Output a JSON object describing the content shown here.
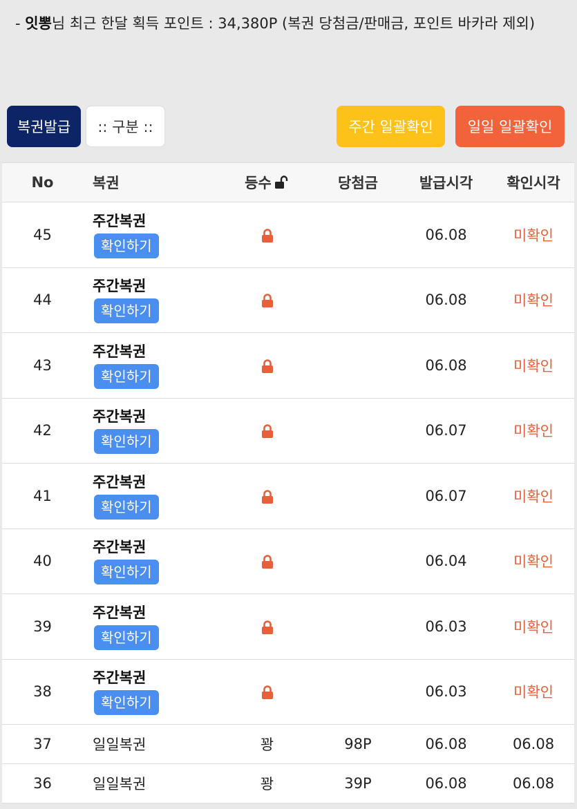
{
  "summary": {
    "prefix": "- ",
    "user": "잇뽕",
    "text": "님 최근 한달 획득 포인트 : 34,380P (복권 당첨금/판매금, 포인트 바카라 제외)"
  },
  "buttons": {
    "issue": "복권발급",
    "filter": ":: 구분 ::",
    "weekly_confirm": "주간 일괄확인",
    "daily_confirm": "일일 일괄확인"
  },
  "table": {
    "headers": {
      "no": "No",
      "lottery": "복권",
      "rank": "등수",
      "prize": "당첨금",
      "issued": "발급시각",
      "checked": "확인시각"
    },
    "rows": [
      {
        "no": "45",
        "name": "주간복권",
        "action": "확인하기",
        "issued": "06.08",
        "checked": "미확인"
      },
      {
        "no": "44",
        "name": "주간복권",
        "action": "확인하기",
        "issued": "06.08",
        "checked": "미확인"
      },
      {
        "no": "43",
        "name": "주간복권",
        "action": "확인하기",
        "issued": "06.08",
        "checked": "미확인"
      },
      {
        "no": "42",
        "name": "주간복권",
        "action": "확인하기",
        "issued": "06.07",
        "checked": "미확인"
      },
      {
        "no": "41",
        "name": "주간복권",
        "action": "확인하기",
        "issued": "06.07",
        "checked": "미확인"
      },
      {
        "no": "40",
        "name": "주간복권",
        "action": "확인하기",
        "issued": "06.04",
        "checked": "미확인"
      },
      {
        "no": "39",
        "name": "주간복권",
        "action": "확인하기",
        "issued": "06.03",
        "checked": "미확인"
      },
      {
        "no": "38",
        "name": "주간복권",
        "action": "확인하기",
        "issued": "06.03",
        "checked": "미확인"
      }
    ],
    "daily_rows": [
      {
        "no": "37",
        "name": "일일복권",
        "rank": "꽝",
        "prize": "98P",
        "issued": "06.08",
        "checked": "06.08"
      },
      {
        "no": "36",
        "name": "일일복권",
        "rank": "꽝",
        "prize": "39P",
        "issued": "06.08",
        "checked": "06.08"
      }
    ]
  },
  "colors": {
    "navy": "#0d2566",
    "yellow": "#fcc21a",
    "orange": "#f2633c",
    "blue": "#4a8ff0",
    "unconfirmed": "#e8603a"
  }
}
